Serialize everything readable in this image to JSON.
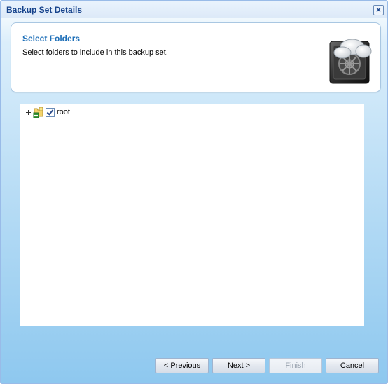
{
  "window": {
    "title": "Backup Set Details"
  },
  "header": {
    "title": "Select Folders",
    "subtitle": "Select folders to include in this backup set.",
    "icon": "cloud-safe-icon"
  },
  "tree": {
    "nodes": [
      {
        "label": "root",
        "checked": true,
        "expanded": false
      }
    ]
  },
  "buttons": {
    "previous": "< Previous",
    "next": "Next >",
    "finish": "Finish",
    "cancel": "Cancel"
  },
  "colors": {
    "title": "#15428b",
    "header_title": "#1e6fb8",
    "accent": "#8ec8ef"
  }
}
